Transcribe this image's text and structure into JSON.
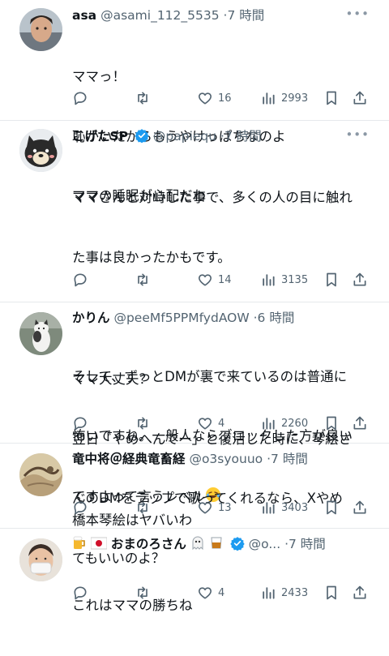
{
  "tweets": [
    {
      "name": "asa",
      "handle": "@asami_112_5535",
      "time": "·7 時間",
      "lines": [
        "ママっ！",
        "恥かいたからもうやけっぱちなのよ",
        "ママの睡眠が心配だわ"
      ],
      "likes": "16",
      "views": "2993"
    },
    {
      "name": "こげたSP",
      "handle": "@papiequ",
      "time": "·7 時間",
      "lines": [
        "ママさんと対峙した事で、多くの人の目に触れ",
        "た事は良かったかもです。",
        "",
        "そして、ずっとDMが裏で来ているのは普通に",
        "怖いですね。一般人ならブロックした方が良い",
        "ですよって言うレベル"
      ],
      "likes": "14",
      "views": "3135"
    },
    {
      "name": "かりん",
      "handle": "@peeMf5PPMfydAOW",
      "time": "·6 時間",
      "lines": [
        "ママ大丈夫？",
        "翌日「やめへんでー」と復活した時に、琴絵さ",
        "んのDMをラップで歌ってくれるなら、Xやめ",
        "てもいいのよ？"
      ],
      "likes": "4",
      "views": "2260"
    },
    {
      "name": "竜中将＠経典竜畜経",
      "handle": "@o3syouuo",
      "time": "·7 時間",
      "lines": [
        "橋本琴絵はヤバいわ"
      ],
      "likes": "13",
      "views": "3403"
    },
    {
      "name": "おまのろさん",
      "handle": "@o...",
      "time": "·7 時間",
      "lines": [
        "これはママの勝ちね"
      ],
      "likes": "4",
      "views": "2433"
    }
  ],
  "icons": {
    "reply": "reply-icon",
    "retweet": "retweet-icon",
    "like": "heart-icon",
    "views": "views-icon",
    "bookmark": "bookmark-icon",
    "share": "share-icon",
    "more": "more-icon",
    "verified": "verified-badge-icon"
  },
  "colors": {
    "verified": "#1d9bf0",
    "secondary": "#536471",
    "border": "#e6e9ec"
  }
}
